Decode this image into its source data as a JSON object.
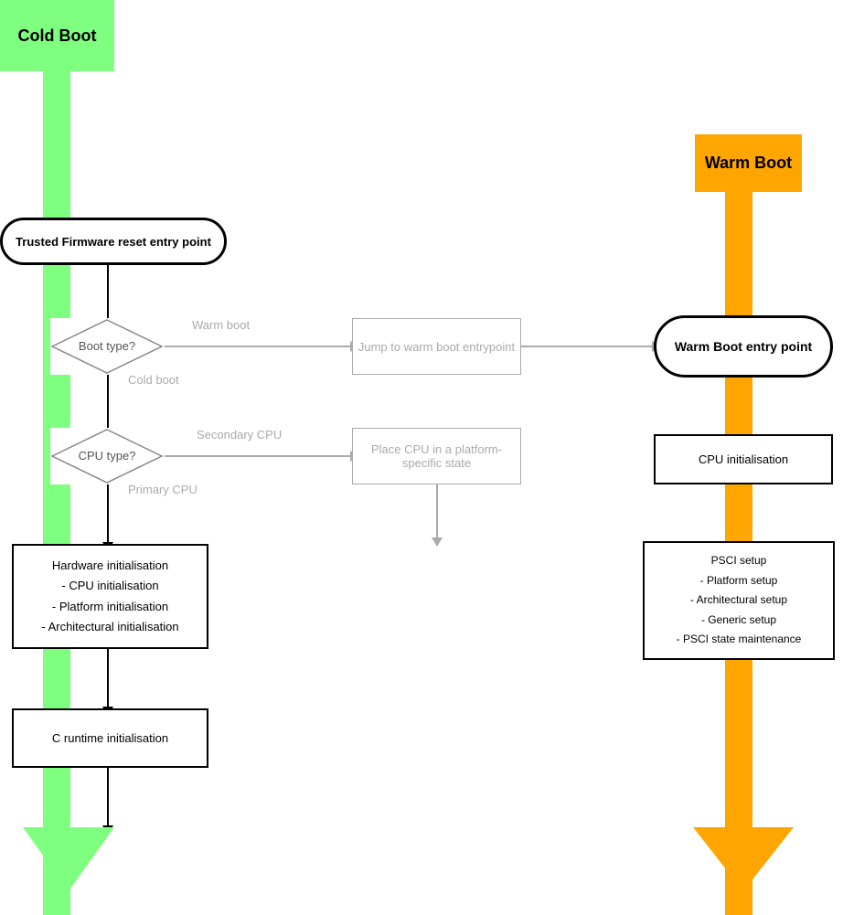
{
  "coldBoot": {
    "label": "Cold Boot",
    "tfReset": "Trusted Firmware reset entry point",
    "bootDiamond": "Boot type?",
    "warmBootLabel": "Warm boot",
    "coldBootLabel": "Cold boot",
    "cpuDiamond": "CPU type?",
    "secondaryCPU": "Secondary CPU",
    "primaryCPU": "Primary CPU",
    "jumpBox": "Jump to warm boot entrypoint",
    "placeBox": "Place CPU in a platform-specific state",
    "hwBox": "Hardware initialisation\n - CPU initialisation\n - Platform initialisation\n- Architectural initialisation",
    "hwBoxLine1": "Hardware initialisation",
    "hwBoxLine2": "- CPU initialisation",
    "hwBoxLine3": "- Platform initialisation",
    "hwBoxLine4": "- Architectural initialisation",
    "crtBox": "C runtime initialisation"
  },
  "warmBoot": {
    "label": "Warm Boot",
    "entryPoint": "Warm Boot entry point",
    "cpuInit": "CPU initialisation",
    "psciLine1": "PSCI setup",
    "psciLine2": "- Platform setup",
    "psciLine3": "- Architectural setup",
    "psciLine4": "- Generic setup",
    "psciLine5": "- PSCI state maintenance"
  },
  "colors": {
    "green": "#7fff7f",
    "orange": "#ffa500",
    "grey": "#aaaaaa",
    "black": "#000000",
    "white": "#ffffff"
  }
}
